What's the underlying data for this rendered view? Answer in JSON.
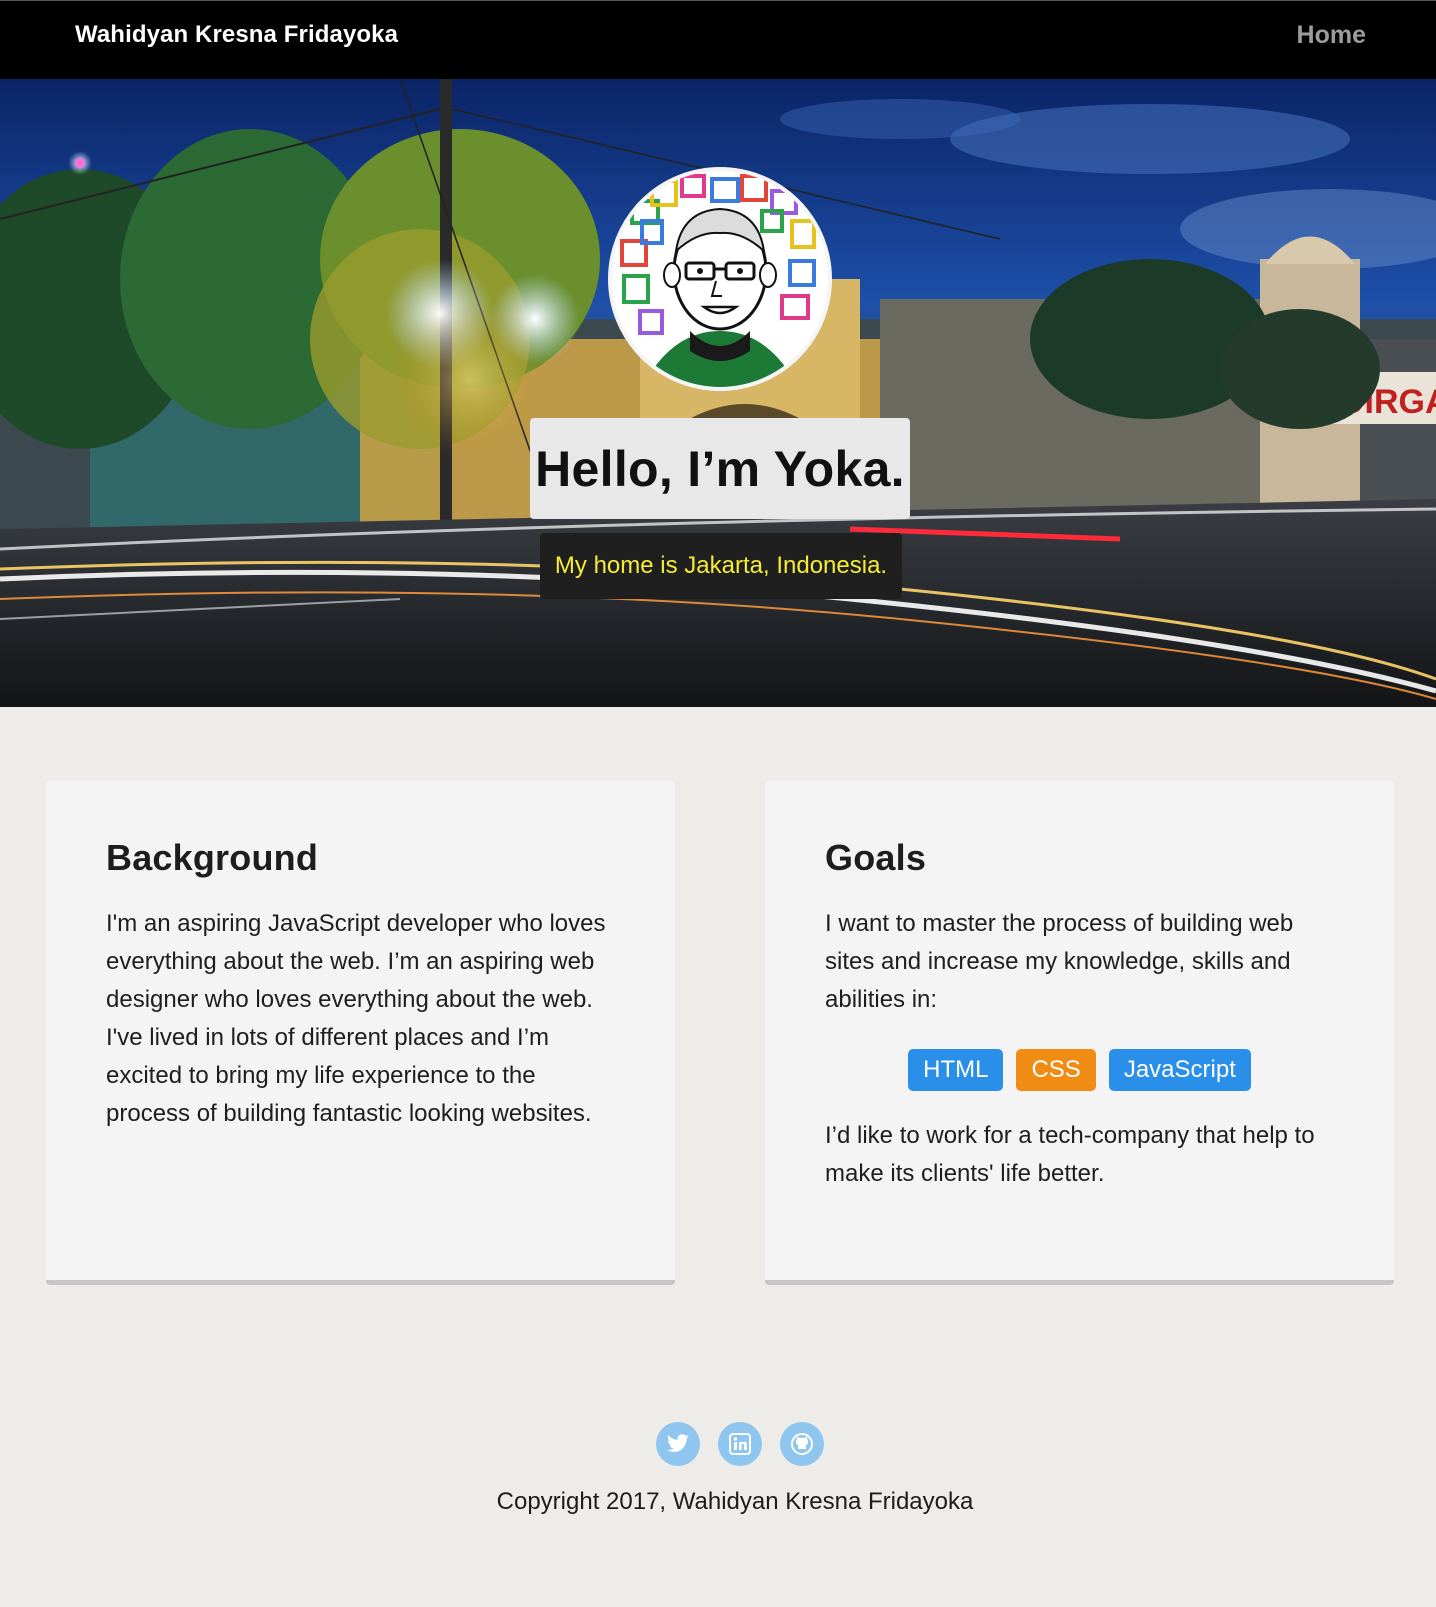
{
  "nav": {
    "brand": "Wahidyan Kresna Fridayoka",
    "home_label": "Home"
  },
  "hero": {
    "greeting": "Hello, I’m Yoka.",
    "subtitle": "My home is Jakarta, Indonesia.",
    "banner_text": "DIRGAHAY"
  },
  "background_card": {
    "title": "Background",
    "body": "I'm an aspiring JavaScript developer who loves everything about the web. I’m an aspiring web designer who loves everything about the web. I've lived in lots of different places and I’m excited to bring my life experience to the process of building fantastic looking websites."
  },
  "goals_card": {
    "title": "Goals",
    "intro": "I want to master the process of building web sites and increase my knowledge, skills and abilities in:",
    "tags": [
      {
        "label": "HTML",
        "color": "#2a8fe8"
      },
      {
        "label": "CSS",
        "color": "#f08c14"
      },
      {
        "label": "JavaScript",
        "color": "#2a8fe8"
      }
    ],
    "outro": "I’d like to work for a tech-company that help to make its clients' life better."
  },
  "footer": {
    "social": [
      "twitter-icon",
      "linkedin-icon",
      "github-icon"
    ],
    "copyright": "Copyright 2017, Wahidyan Kresna Fridayoka"
  },
  "colors": {
    "navbar": "#000000",
    "page_bg": "#eeece8",
    "card_bg": "#f4f4f4",
    "subtitle_text": "#f7ec34",
    "tag_blue": "#2a8fe8",
    "tag_orange": "#f08c14",
    "social_icon_bg": "#8ec6ef"
  }
}
